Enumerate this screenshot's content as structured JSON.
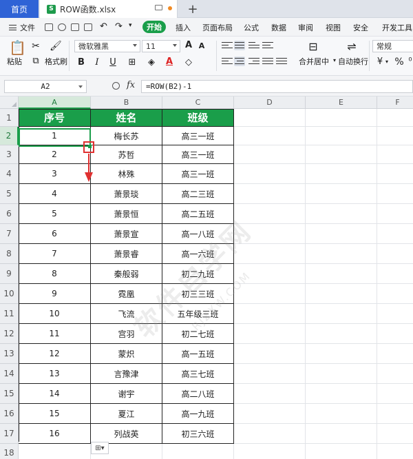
{
  "tabs": {
    "home": "首页",
    "file": "ROW函数.xlsx",
    "file_icon": "S"
  },
  "menu": {
    "file": "文件",
    "start": "开始",
    "items": [
      "插入",
      "页面布局",
      "公式",
      "数据",
      "审阅",
      "视图",
      "安全",
      "开发工具"
    ]
  },
  "ribbon": {
    "paste": "粘贴",
    "format_painter": "格式刷",
    "font_name": "微软雅黑",
    "font_size": "11",
    "merge_center": "合并居中",
    "wrap_text": "自动换行",
    "number_format": "常规",
    "bold": "B",
    "italic": "I",
    "underline": "U",
    "percent": "%",
    "increase_font": "A",
    "decrease_font": "A",
    "font_color": "A"
  },
  "formula_bar": {
    "name_box": "A2",
    "fx": "fx",
    "formula": "=ROW(B2)-1"
  },
  "grid": {
    "columns": [
      "A",
      "B",
      "C",
      "D",
      "E",
      "F"
    ],
    "rows": [
      "1",
      "2",
      "3",
      "4",
      "5",
      "6",
      "7",
      "8",
      "9",
      "10",
      "11",
      "12",
      "13",
      "14",
      "15",
      "16",
      "17",
      "18"
    ],
    "selected_cell": "A2",
    "headers": [
      "序号",
      "姓名",
      "班级"
    ],
    "records": [
      {
        "no": "1",
        "name": "梅长苏",
        "class": "高三一班"
      },
      {
        "no": "2",
        "name": "苏哲",
        "class": "高三一班"
      },
      {
        "no": "3",
        "name": "林殊",
        "class": "高三一班"
      },
      {
        "no": "4",
        "name": "萧景琰",
        "class": "高二三班"
      },
      {
        "no": "5",
        "name": "萧景恒",
        "class": "高二五班"
      },
      {
        "no": "6",
        "name": "萧景宣",
        "class": "高一八班"
      },
      {
        "no": "7",
        "name": "萧景睿",
        "class": "高一六班"
      },
      {
        "no": "8",
        "name": "秦般弱",
        "class": "初二九班"
      },
      {
        "no": "9",
        "name": "霓凰",
        "class": "初三三班"
      },
      {
        "no": "10",
        "name": "飞流",
        "class": "五年级三班"
      },
      {
        "no": "11",
        "name": "宫羽",
        "class": "初二七班"
      },
      {
        "no": "12",
        "name": "蒙炽",
        "class": "高一五班"
      },
      {
        "no": "13",
        "name": "言豫津",
        "class": "高三七班"
      },
      {
        "no": "14",
        "name": "谢宇",
        "class": "高二八班"
      },
      {
        "no": "15",
        "name": "夏江",
        "class": "高一九班"
      },
      {
        "no": "16",
        "name": "列战英",
        "class": "初三六班"
      }
    ]
  },
  "watermark": {
    "main": "软件自学网",
    "url": "RJZXW.COM"
  },
  "colors": {
    "accent": "#1a9e4a",
    "annotation": "#e03030",
    "tab_active": "#2f63d6"
  }
}
